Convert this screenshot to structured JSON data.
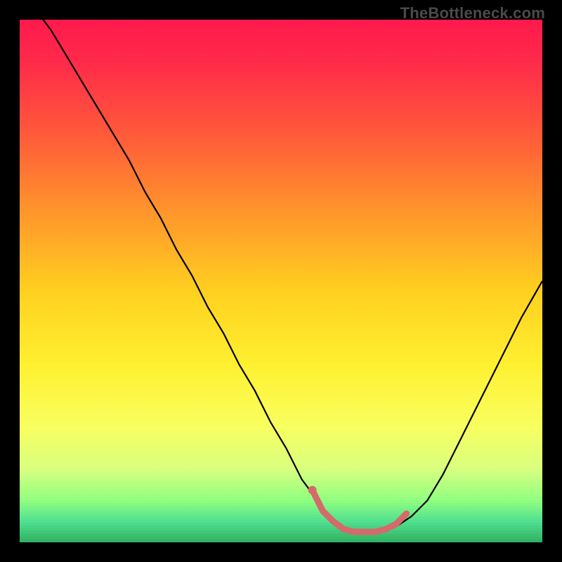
{
  "watermark": {
    "text": "TheBottleneck.com"
  },
  "colors": {
    "page_bg": "#000000",
    "curve_stroke": "#000000",
    "highlight_segment": "#d46a6a",
    "gradient_top": "#ff1a4d",
    "gradient_bottom": "#30b060"
  },
  "chart_data": {
    "type": "line",
    "title": "",
    "xlabel": "",
    "ylabel": "",
    "xlim": [
      0,
      100
    ],
    "ylim": [
      0,
      100
    ],
    "grid": false,
    "legend": false,
    "x": [
      0,
      3,
      6,
      9,
      12,
      15,
      18,
      21,
      24,
      27,
      30,
      33,
      36,
      39,
      42,
      45,
      48,
      51,
      54,
      57,
      60,
      63,
      66,
      69,
      72,
      75,
      78,
      81,
      84,
      87,
      90,
      93,
      96,
      100
    ],
    "values": [
      105,
      102,
      98,
      93,
      88,
      83,
      78,
      73,
      67,
      62,
      56,
      51,
      45,
      40,
      34,
      29,
      23,
      18,
      12,
      8,
      4,
      2,
      2,
      2,
      3,
      5,
      8,
      13,
      19,
      25,
      31,
      37,
      43,
      50
    ],
    "highlight_segment": {
      "x": [
        56,
        58,
        60,
        62,
        64,
        66,
        68,
        70,
        72,
        74
      ],
      "values": [
        10,
        6,
        4,
        2.5,
        2,
        2,
        2,
        2.5,
        3.5,
        5.5
      ]
    },
    "notes": "V-shaped bottleneck curve. Y encodes bottleneck percentage (high = red/top = bad, low = green/bottom = good). X is a normalized hardware-balance axis (no visible tick labels). Values are read visually from the rendered image; the vertical gradient is the only scale cue so precision is ~±3."
  }
}
